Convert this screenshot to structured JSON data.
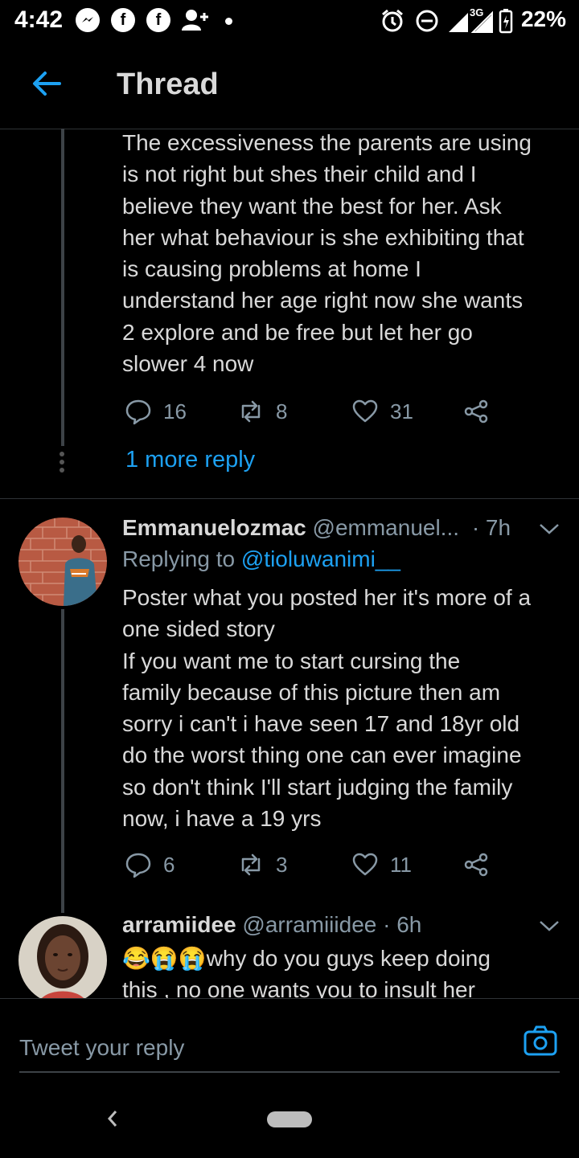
{
  "status_bar": {
    "time": "4:42",
    "right": "22%",
    "icons": [
      "messenger-icon",
      "facebook-icon",
      "facebook-icon",
      "add-user-icon",
      "alarm-icon",
      "do-not-disturb-icon",
      "signal-icon",
      "battery-icon"
    ],
    "network": "3G"
  },
  "header": {
    "title": "Thread"
  },
  "tweet1": {
    "text": "The excessiveness the parents are using\nis not right but shes their child and I\nbelieve they want the best for her. Ask\nher what behaviour is she exhibiting that\nis causing problems at home I\nunderstand her age right now she wants\n2 explore and be free but let her go\nslower 4 now",
    "replies": "16",
    "retweets": "8",
    "likes": "31"
  },
  "more_reply": "1 more reply",
  "tweet2": {
    "name": "Emmanuelozmac",
    "handle": "@emmanuel...",
    "time": "· 7h",
    "replying_prefix": "Replying to",
    "replying_to": "@tioluwanimi__",
    "text": "Poster what you posted her it's more of a\none sided story\nIf you want me to start cursing the\nfamily because of this picture then am\nsorry i can't i have seen 17 and 18yr old\ndo the worst thing one can ever imagine\nso don't think I'll start judging the family\nnow, i have a 19 yrs",
    "replies": "6",
    "retweets": "3",
    "likes": "11"
  },
  "tweet3": {
    "name": "arramiidee",
    "handle": "@arramiiidee",
    "time": "· 6h",
    "emojis": "😂😭😭",
    "text": "why do you guys keep doing\nthis , no one wants you to insult her"
  },
  "reply_bar": {
    "placeholder": "Tweet your reply"
  },
  "colors": {
    "accent": "#1da1f2",
    "muted": "#8899a6",
    "text": "#d9d9d9",
    "background": "#000000"
  }
}
